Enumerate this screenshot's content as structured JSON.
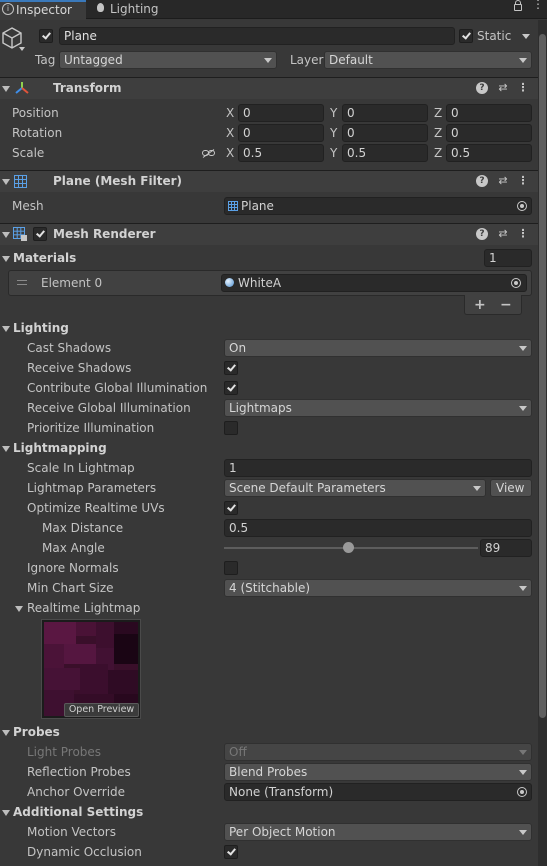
{
  "tabs": {
    "inspector": "Inspector",
    "lighting": "Lighting"
  },
  "object": {
    "name": "Plane",
    "static_label": "Static",
    "tag_label": "Tag",
    "tag_value": "Untagged",
    "layer_label": "Layer",
    "layer_value": "Default"
  },
  "transform": {
    "title": "Transform",
    "position_label": "Position",
    "rotation_label": "Rotation",
    "scale_label": "Scale",
    "position": {
      "x": "0",
      "y": "0",
      "z": "0"
    },
    "rotation": {
      "x": "0",
      "y": "0",
      "z": "0"
    },
    "scale": {
      "x": "0.5",
      "y": "0.5",
      "z": "0.5"
    },
    "axis_x": "X",
    "axis_y": "Y",
    "axis_z": "Z"
  },
  "mesh_filter": {
    "title": "Plane (Mesh Filter)",
    "mesh_label": "Mesh",
    "mesh_value": "Plane"
  },
  "mesh_renderer": {
    "title": "Mesh Renderer",
    "materials_label": "Materials",
    "materials_count": "1",
    "element0_label": "Element 0",
    "element0_value": "WhiteA",
    "add_label": "+",
    "remove_label": "−",
    "lighting": {
      "title": "Lighting",
      "cast_shadows_label": "Cast Shadows",
      "cast_shadows_value": "On",
      "receive_shadows_label": "Receive Shadows",
      "contribute_gi_label": "Contribute Global Illumination",
      "receive_gi_label": "Receive Global Illumination",
      "receive_gi_value": "Lightmaps",
      "prioritize_label": "Prioritize Illumination"
    },
    "lightmapping": {
      "title": "Lightmapping",
      "scale_label": "Scale In Lightmap",
      "scale_value": "1",
      "params_label": "Lightmap Parameters",
      "params_value": "Scene Default Parameters",
      "view_label": "View",
      "optimize_label": "Optimize Realtime UVs",
      "max_distance_label": "Max Distance",
      "max_distance_value": "0.5",
      "max_angle_label": "Max Angle",
      "max_angle_value": "89",
      "max_angle_slider": 0.49,
      "ignore_normals_label": "Ignore Normals",
      "min_chart_label": "Min Chart Size",
      "min_chart_value": "4 (Stitchable)",
      "realtime_lightmap_label": "Realtime Lightmap",
      "open_preview_label": "Open Preview"
    },
    "probes": {
      "title": "Probes",
      "light_probes_label": "Light Probes",
      "light_probes_value": "Off",
      "reflection_probes_label": "Reflection Probes",
      "reflection_probes_value": "Blend Probes",
      "anchor_label": "Anchor Override",
      "anchor_value": "None (Transform)"
    },
    "additional": {
      "title": "Additional Settings",
      "motion_vectors_label": "Motion Vectors",
      "motion_vectors_value": "Per Object Motion",
      "dynamic_occlusion_label": "Dynamic Occlusion"
    }
  },
  "colors": {
    "panel_bg": "#383838",
    "header_bg": "#3e3e3e",
    "field_bg": "#2a2a2a",
    "dropdown_bg": "#515151",
    "text": "#c4c4c4"
  }
}
